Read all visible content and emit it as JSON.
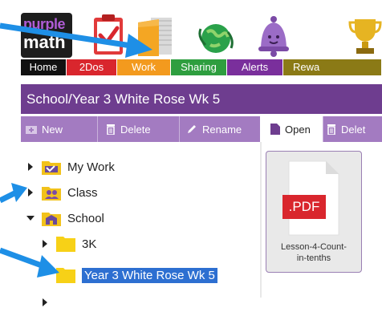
{
  "brand": {
    "line1": "purple",
    "line2": "math"
  },
  "nav_tabs": [
    {
      "label": "Home",
      "color": "#111111"
    },
    {
      "label": "2Dos",
      "color": "#d9262d"
    },
    {
      "label": "Work",
      "color": "#f39a1e"
    },
    {
      "label": "Sharing",
      "color": "#2e9e3f"
    },
    {
      "label": "Alerts",
      "color": "#7a2f9c"
    },
    {
      "label": "Rewa",
      "color": "#8b7a16"
    }
  ],
  "app_icons": [
    "clipboard-check-icon",
    "folder-notebook-icon",
    "globe-icon",
    "alert-bell-icon",
    "trophy-icon"
  ],
  "path_title": "School/Year 3 White Rose Wk 5",
  "toolbar_left": {
    "new": "New",
    "delete": "Delete",
    "rename": "Rename"
  },
  "toolbar_right": {
    "open": "Open",
    "delete": "Delet"
  },
  "tree": {
    "my_work": "My Work",
    "class": "Class",
    "school": "School",
    "3k": "3K",
    "year3": "Year 3 White Rose Wk 5"
  },
  "file": {
    "badge": ".PDF",
    "name_line1": "Lesson-4-Count-",
    "name_line2": "in-tenths"
  },
  "colors": {
    "accent": "#6e3d8f",
    "toolbar": "#a37bc1",
    "annotation_arrow": "#1e8fe6",
    "selection": "#2d6fd1"
  }
}
